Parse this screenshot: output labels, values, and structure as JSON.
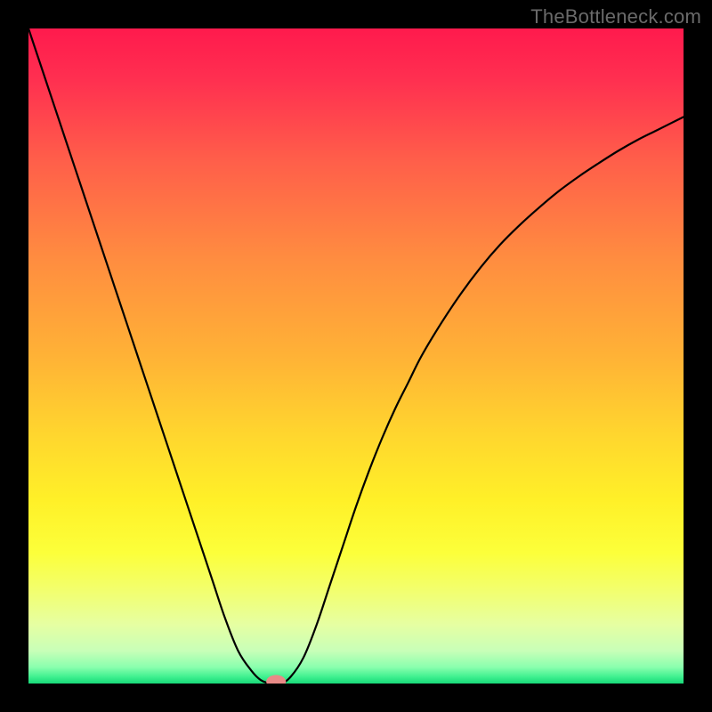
{
  "watermark": "TheBottleneck.com",
  "chart_data": {
    "type": "line",
    "title": "",
    "xlabel": "",
    "ylabel": "",
    "xlim": [
      0,
      1
    ],
    "ylim": [
      0,
      1
    ],
    "series": [
      {
        "name": "bottleneck-curve",
        "x": [
          0.0,
          0.02,
          0.04,
          0.06,
          0.08,
          0.1,
          0.12,
          0.14,
          0.16,
          0.18,
          0.2,
          0.22,
          0.24,
          0.26,
          0.28,
          0.3,
          0.32,
          0.34,
          0.355,
          0.37,
          0.385,
          0.4,
          0.42,
          0.44,
          0.46,
          0.48,
          0.5,
          0.52,
          0.54,
          0.56,
          0.58,
          0.6,
          0.63,
          0.66,
          0.69,
          0.72,
          0.75,
          0.78,
          0.81,
          0.84,
          0.87,
          0.9,
          0.93,
          0.96,
          1.0
        ],
        "values": [
          1.0,
          0.94,
          0.88,
          0.82,
          0.76,
          0.7,
          0.64,
          0.58,
          0.52,
          0.46,
          0.4,
          0.34,
          0.28,
          0.22,
          0.16,
          0.1,
          0.05,
          0.02,
          0.005,
          0.0,
          0.0,
          0.01,
          0.04,
          0.09,
          0.15,
          0.21,
          0.27,
          0.325,
          0.375,
          0.42,
          0.46,
          0.5,
          0.55,
          0.595,
          0.635,
          0.67,
          0.7,
          0.727,
          0.752,
          0.774,
          0.794,
          0.813,
          0.83,
          0.845,
          0.865
        ]
      }
    ],
    "gradient_stops": [
      {
        "offset": 0.0,
        "color": "#ff1a4d"
      },
      {
        "offset": 0.08,
        "color": "#ff3050"
      },
      {
        "offset": 0.2,
        "color": "#ff5e4a"
      },
      {
        "offset": 0.35,
        "color": "#ff8c40"
      },
      {
        "offset": 0.5,
        "color": "#ffb236"
      },
      {
        "offset": 0.62,
        "color": "#ffd62e"
      },
      {
        "offset": 0.72,
        "color": "#fff028"
      },
      {
        "offset": 0.8,
        "color": "#fcff3a"
      },
      {
        "offset": 0.86,
        "color": "#f2ff70"
      },
      {
        "offset": 0.91,
        "color": "#e6ffa2"
      },
      {
        "offset": 0.95,
        "color": "#c8ffb8"
      },
      {
        "offset": 0.975,
        "color": "#8affae"
      },
      {
        "offset": 0.99,
        "color": "#3ef08f"
      },
      {
        "offset": 1.0,
        "color": "#18d878"
      }
    ],
    "marker": {
      "x": 0.378,
      "y": 0.003,
      "rx": 0.015,
      "ry": 0.01,
      "color": "#e98a87"
    }
  }
}
